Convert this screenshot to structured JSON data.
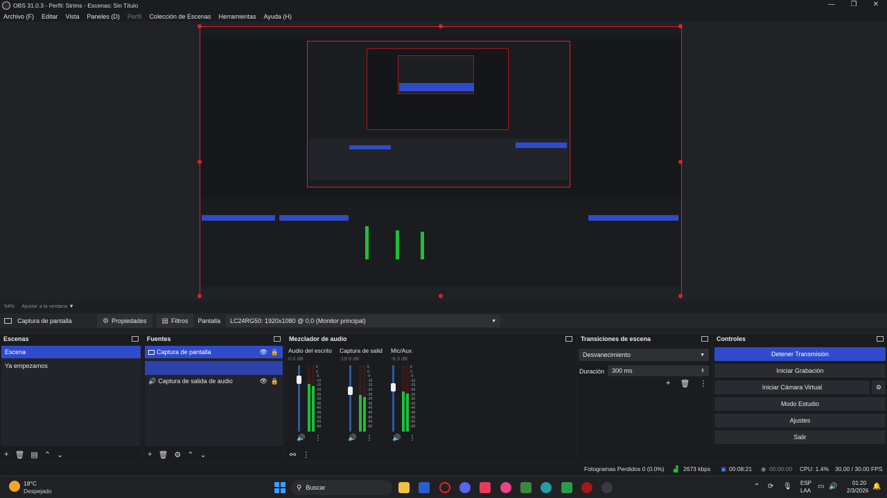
{
  "window": {
    "title": "OBS 31.0.3 - Perfil: Strims - Escenas: Sin Título",
    "controls": [
      "—",
      "❐",
      "✕"
    ]
  },
  "menu": {
    "items": [
      "Archivo (F)",
      "Editar",
      "Vista",
      "Paneles (D)",
      "Perfil",
      "Colección de Escenas",
      "Herramientas",
      "Ayuda (H)"
    ]
  },
  "preview": {
    "zoom": "54%",
    "fit_label": "Ajustar a la ventana"
  },
  "source_toolbar": {
    "source_name": "Captura de pantalla",
    "properties_label": "Propiedades",
    "filters_label": "Filtros",
    "display_label": "Pantalla",
    "display_value": "LC24RG50: 1920x1080 @ 0,0 (Monitor principal)"
  },
  "scenes": {
    "title": "Escenas",
    "items": [
      "Escena",
      "Ya empezamos"
    ],
    "selected": 0
  },
  "sources": {
    "title": "Fuentes",
    "items": [
      "Captura de pantalla",
      "Captura de salida de audio"
    ]
  },
  "mixer": {
    "title": "Mezclador de audio",
    "channels": [
      {
        "name": "Audio del escrito",
        "db": "0.0 dB",
        "level": 0.72
      },
      {
        "name": "Captura de salid",
        "db": "-19.9 dB",
        "level": 0.55
      },
      {
        "name": "Mic/Aux",
        "db": "-8.3 dB",
        "level": 0.6
      }
    ],
    "scale": [
      "5",
      "0",
      "-5",
      "-10",
      "-15",
      "-20",
      "-25",
      "-30",
      "-35",
      "-40",
      "-45",
      "-50",
      "-55",
      "-60"
    ]
  },
  "transitions": {
    "title": "Transiciones de escena",
    "selected": "Desvanecimiento",
    "duration_label": "Duración",
    "duration_value": "300 ms"
  },
  "controls": {
    "title": "Controles",
    "stop_stream": "Detener Transmisión",
    "start_recording": "Iniciar Grabación",
    "start_virtual_cam": "Iniciar Cámara Virtual",
    "studio_mode": "Modo Estudio",
    "settings": "Ajustes",
    "exit": "Salir"
  },
  "status": {
    "dropped_frames": "Fotogramas Perdidos 0 (0.0%)",
    "bitrate": "2673 kbps",
    "stream_time": "00:08:21",
    "rec_time": "00:00:00",
    "cpu": "CPU: 1.4%",
    "fps": "30.00 / 30.00 FPS"
  },
  "taskbar": {
    "weather_temp": "18°C",
    "weather_desc": "Despejado",
    "search_placeholder": "Buscar",
    "lang": "ESP",
    "lang2": "LAA",
    "time": "01:20",
    "date": "2/3/2026"
  },
  "colors": {
    "accent": "#2f4bcc",
    "selection_border": "#e1222b",
    "meter_green": "#1fbf3a"
  }
}
